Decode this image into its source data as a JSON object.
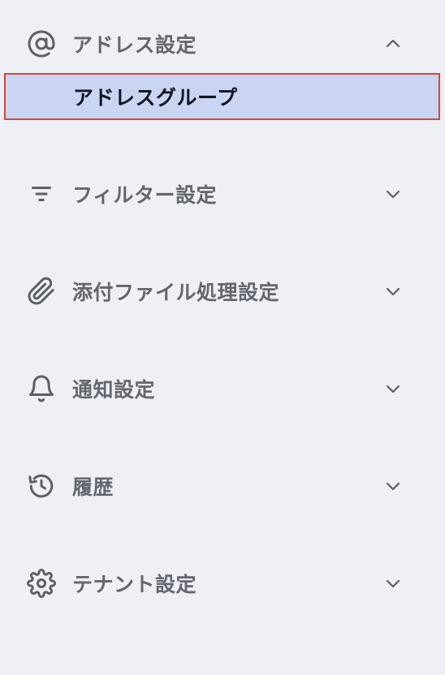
{
  "sidebar": {
    "sections": [
      {
        "label": "アドレス設定",
        "icon": "at-icon",
        "expanded": true,
        "children": [
          {
            "label": "アドレスグループ",
            "selected": true
          }
        ]
      },
      {
        "label": "フィルター設定",
        "icon": "filter-icon",
        "expanded": false
      },
      {
        "label": "添付ファイル処理設定",
        "icon": "paperclip-icon",
        "expanded": false
      },
      {
        "label": "通知設定",
        "icon": "bell-icon",
        "expanded": false
      },
      {
        "label": "履歴",
        "icon": "history-icon",
        "expanded": false
      },
      {
        "label": "テナント設定",
        "icon": "gear-icon",
        "expanded": false
      }
    ]
  },
  "colors": {
    "background": "#eef0f5",
    "selected_background": "#c9d5f1",
    "selected_border": "#d8463a",
    "label": "#62666d",
    "selected_label": "#111522"
  }
}
